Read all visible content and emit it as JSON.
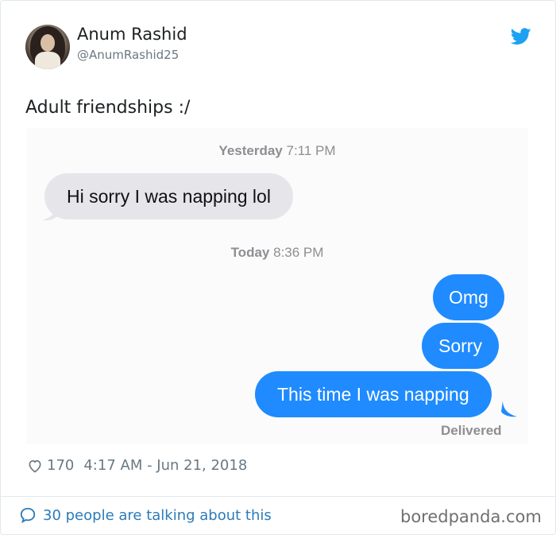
{
  "author": {
    "name": "Anum Rashid",
    "handle": "@AnumRashid25"
  },
  "tweet": {
    "text": "Adult friendships :/"
  },
  "chat": {
    "timestamp1": {
      "day": "Yesterday",
      "time": "7:11 PM"
    },
    "incoming_message": "Hi sorry I was napping lol",
    "timestamp2": {
      "day": "Today",
      "time": "8:36 PM"
    },
    "outgoing_messages": [
      "Omg",
      "Sorry",
      "This time I was napping"
    ],
    "status": "Delivered"
  },
  "meta": {
    "likes": "170",
    "datetime": "4:17 AM - Jun 21, 2018"
  },
  "footer": {
    "talking": "30 people are talking about this",
    "brand": "boredpanda.com"
  },
  "colors": {
    "twitter_blue": "#1da1f2",
    "imessage_blue": "#1f8bff",
    "incoming_gray": "#e5e5ea",
    "link_blue": "#2b7bb9"
  },
  "icons": [
    "twitter-bird-icon",
    "heart-icon",
    "speech-bubble-icon"
  ]
}
